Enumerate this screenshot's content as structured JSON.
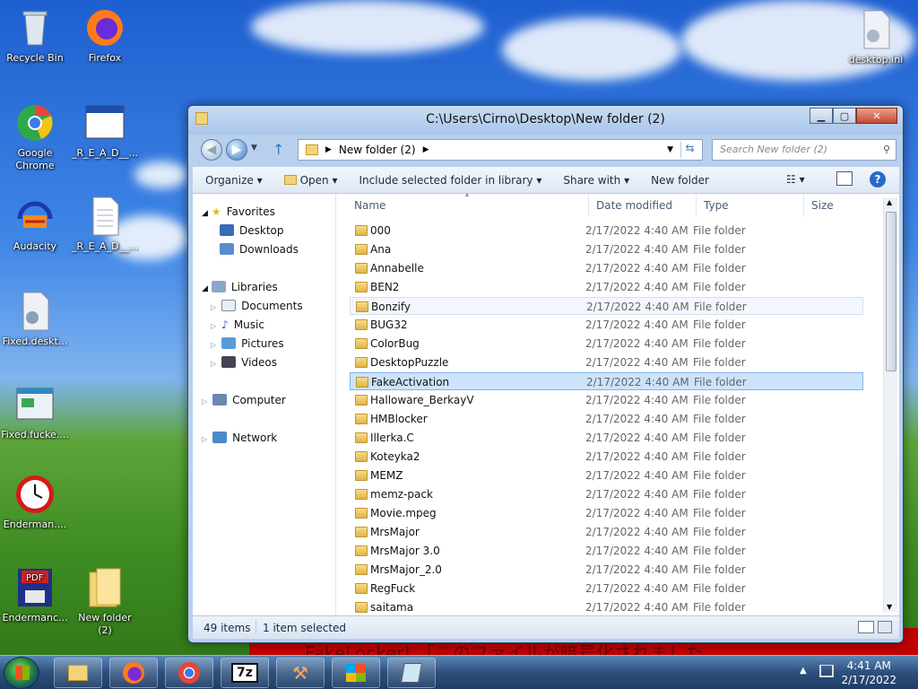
{
  "desktop": {
    "icons": [
      {
        "label": "Recycle Bin",
        "icon": "recycle-bin-icon"
      },
      {
        "label": "Firefox",
        "icon": "firefox-icon"
      },
      {
        "label": "Google Chrome",
        "icon": "chrome-icon"
      },
      {
        "label": "_R_E_A_D__...",
        "icon": "window-file-icon"
      },
      {
        "label": "Audacity",
        "icon": "audacity-icon"
      },
      {
        "label": "_R_E_A_D__...",
        "icon": "text-file-icon"
      },
      {
        "label": "Fixed.deskt...",
        "icon": "settings-file-icon"
      },
      {
        "label": "Fixed.fucke....",
        "icon": "app-window-icon"
      },
      {
        "label": "Enderman....",
        "icon": "clock-icon"
      },
      {
        "label": "Endermanc...",
        "icon": "pdf-icon"
      },
      {
        "label": "New folder (2)",
        "icon": "folder-icon"
      },
      {
        "label": "desktop.ini",
        "icon": "settings-file-icon"
      }
    ],
    "banner_text": "FakeLocker! 「このファイルが暗号化されました"
  },
  "window": {
    "title": "C:\\Users\\Cirno\\Desktop\\New folder (2)",
    "address": "New folder (2)",
    "search_placeholder": "Search New folder (2)",
    "toolbar": {
      "organize": "Organize",
      "open": "Open",
      "include": "Include selected folder in library",
      "share": "Share with",
      "new_folder": "New folder"
    },
    "nav": {
      "favorites": "Favorites",
      "desktop": "Desktop",
      "downloads": "Downloads",
      "libraries": "Libraries",
      "documents": "Documents",
      "music": "Music",
      "pictures": "Pictures",
      "videos": "Videos",
      "computer": "Computer",
      "network": "Network"
    },
    "columns": {
      "name": "Name",
      "date": "Date modified",
      "type": "Type",
      "size": "Size"
    },
    "files": [
      {
        "name": "000",
        "date": "2/17/2022 4:40 AM",
        "type": "File folder"
      },
      {
        "name": "Ana",
        "date": "2/17/2022 4:40 AM",
        "type": "File folder"
      },
      {
        "name": "Annabelle",
        "date": "2/17/2022 4:40 AM",
        "type": "File folder"
      },
      {
        "name": "BEN2",
        "date": "2/17/2022 4:40 AM",
        "type": "File folder"
      },
      {
        "name": "Bonzify",
        "date": "2/17/2022 4:40 AM",
        "type": "File folder"
      },
      {
        "name": "BUG32",
        "date": "2/17/2022 4:40 AM",
        "type": "File folder"
      },
      {
        "name": "ColorBug",
        "date": "2/17/2022 4:40 AM",
        "type": "File folder"
      },
      {
        "name": "DesktopPuzzle",
        "date": "2/17/2022 4:40 AM",
        "type": "File folder"
      },
      {
        "name": "FakeActivation",
        "date": "2/17/2022 4:40 AM",
        "type": "File folder"
      },
      {
        "name": "Halloware_BerkayV",
        "date": "2/17/2022 4:40 AM",
        "type": "File folder"
      },
      {
        "name": "HMBlocker",
        "date": "2/17/2022 4:40 AM",
        "type": "File folder"
      },
      {
        "name": "Illerka.C",
        "date": "2/17/2022 4:40 AM",
        "type": "File folder"
      },
      {
        "name": "Koteyka2",
        "date": "2/17/2022 4:40 AM",
        "type": "File folder"
      },
      {
        "name": "MEMZ",
        "date": "2/17/2022 4:40 AM",
        "type": "File folder"
      },
      {
        "name": "memz-pack",
        "date": "2/17/2022 4:40 AM",
        "type": "File folder"
      },
      {
        "name": "Movie.mpeg",
        "date": "2/17/2022 4:40 AM",
        "type": "File folder"
      },
      {
        "name": "MrsMajor",
        "date": "2/17/2022 4:40 AM",
        "type": "File folder"
      },
      {
        "name": "MrsMajor 3.0",
        "date": "2/17/2022 4:40 AM",
        "type": "File folder"
      },
      {
        "name": "MrsMajor_2.0",
        "date": "2/17/2022 4:40 AM",
        "type": "File folder"
      },
      {
        "name": "RegFuck",
        "date": "2/17/2022 4:40 AM",
        "type": "File folder"
      },
      {
        "name": "saitama",
        "date": "2/17/2022 4:40 AM",
        "type": "File folder"
      }
    ],
    "status": {
      "items": "49 items",
      "selected": "1 item selected"
    }
  },
  "taskbar": {
    "apps": [
      "explorer-icon",
      "firefox-icon",
      "chrome-icon",
      "7zip-icon",
      "hammer-icon",
      "winxp-flag-icon",
      "notepad-icon"
    ],
    "seven_zip_label": "7z",
    "time": "4:41 AM",
    "date": "2/17/2022"
  }
}
